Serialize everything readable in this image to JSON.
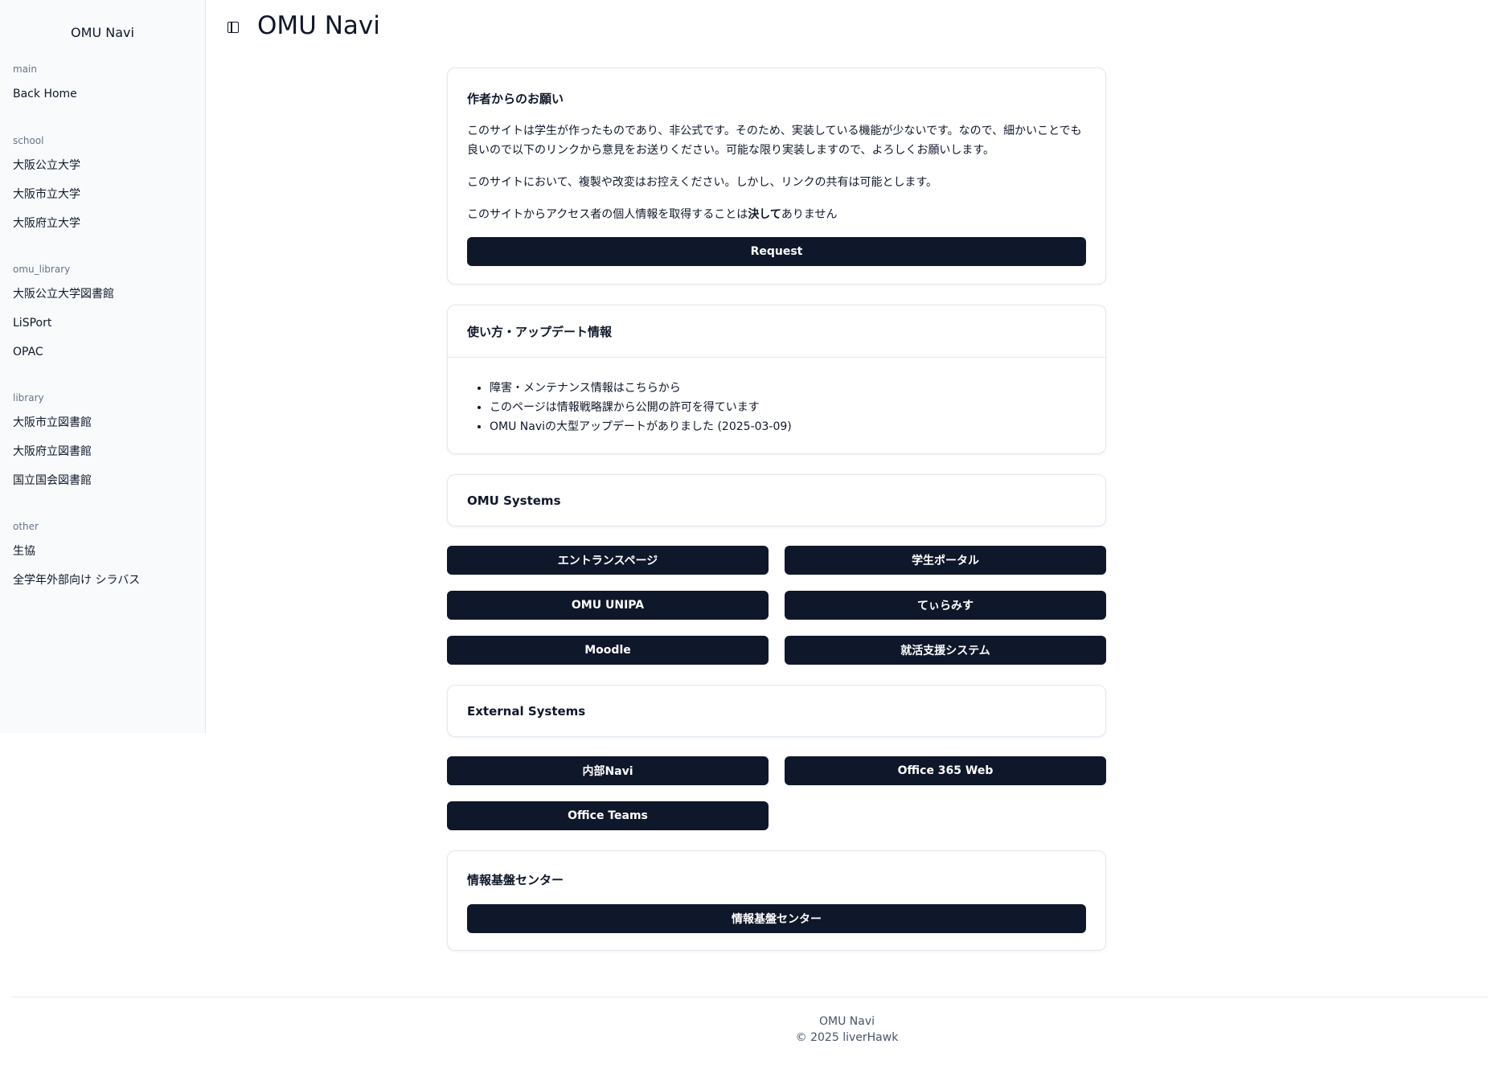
{
  "sidebar": {
    "title": "OMU Navi",
    "groups": [
      {
        "label": "main",
        "items": [
          "Back Home"
        ]
      },
      {
        "label": "school",
        "items": [
          "大阪公立大学",
          "大阪市立大学",
          "大阪府立大学"
        ]
      },
      {
        "label": "omu_library",
        "items": [
          "大阪公立大学図書館",
          "LiSPort",
          "OPAC"
        ]
      },
      {
        "label": "library",
        "items": [
          "大阪市立図書館",
          "大阪府立図書館",
          "国立国会図書館"
        ]
      },
      {
        "label": "other",
        "items": [
          "生協",
          "全学年外部向け シラバス"
        ]
      }
    ]
  },
  "header": {
    "title": "OMU Navi",
    "toggle_icon": "sidebar-toggle-icon"
  },
  "request_card": {
    "title": "作者からのお願い",
    "paragraphs": [
      "このサイトは学生が作ったものであり、非公式です。そのため、実装している機能が少ないです。なので、細かいことでも良いので以下のリンクから意見をお送りください。可能な限り実装しますので、よろしくお願いします。",
      "このサイトにおいて、複製や改変はお控えください。しかし、リンクの共有は可能とします。"
    ],
    "privacy_prefix": "このサイトからアクセス者の個人情報を取得することは",
    "privacy_emphasis": "決して",
    "privacy_suffix": "ありません",
    "button": "Request"
  },
  "info_card": {
    "title": "使い方・アップデート情報",
    "items": [
      "障害・メンテナンス情報はこちらから",
      "このページは情報戦略課から公開の許可を得ています",
      "OMU Naviの大型アップデートがありました (2025-03-09)"
    ]
  },
  "omu_systems": {
    "title": "OMU Systems",
    "buttons": [
      "エントランスページ",
      "学生ポータル",
      "OMU UNIPA",
      "てぃらみす",
      "Moodle",
      "就活支援システム"
    ]
  },
  "external_systems": {
    "title": "External Systems",
    "buttons": [
      "内部Navi",
      "Office 365 Web",
      "Office Teams"
    ]
  },
  "info_center": {
    "title": "情報基盤センター",
    "button": "情報基盤センター"
  },
  "footer": {
    "name": "OMU Navi",
    "copyright": "© 2025 liverHawk"
  },
  "colors": {
    "button_bg": "#0f172a",
    "sidebar_bg": "#f8fafc",
    "border": "#e2e8f0"
  }
}
